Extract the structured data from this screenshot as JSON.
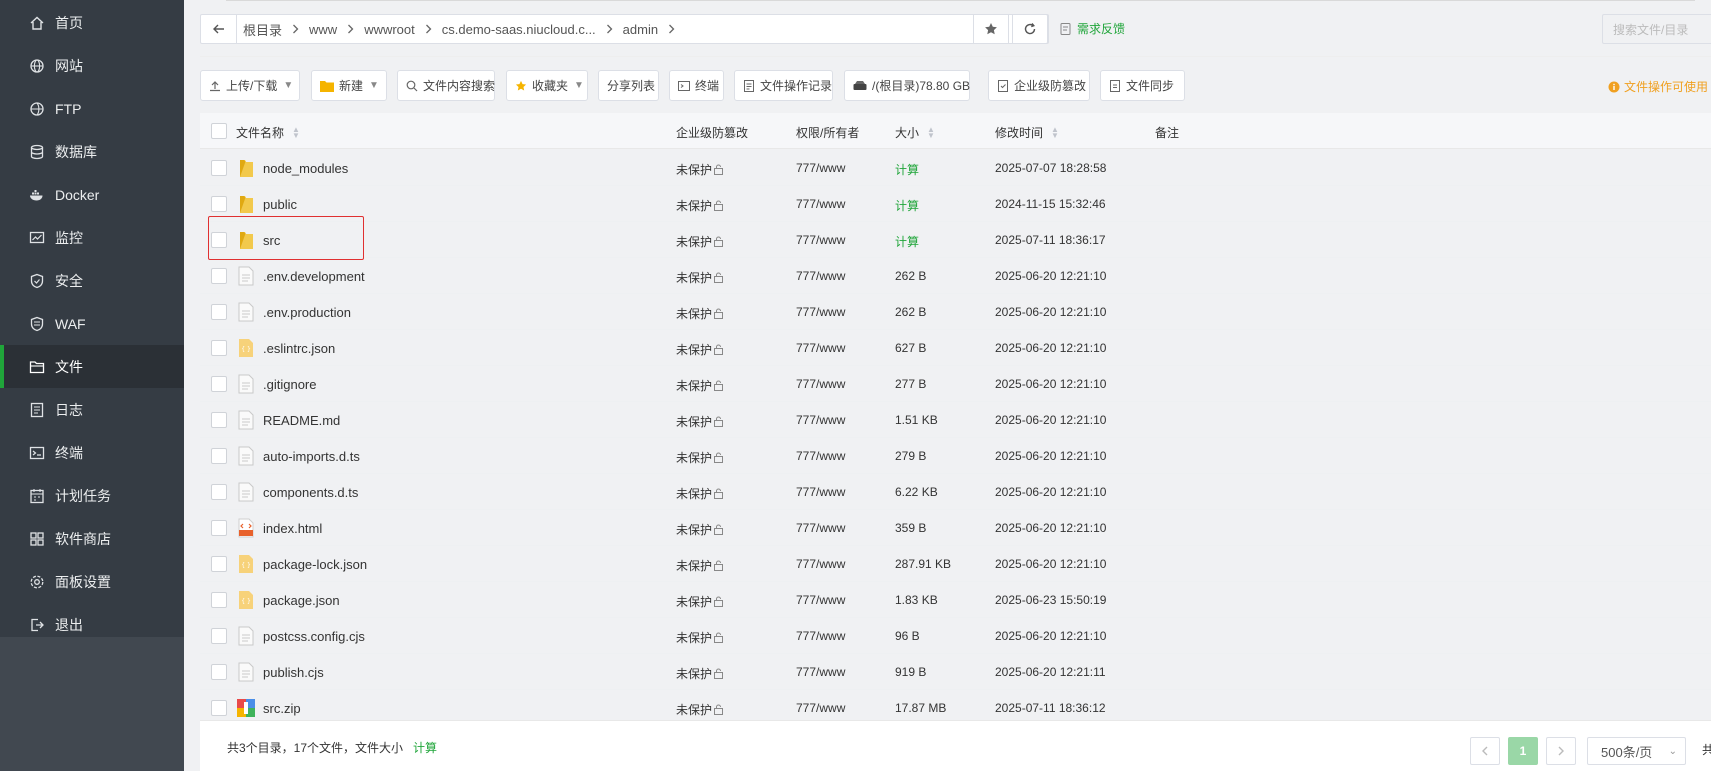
{
  "sidebar": {
    "items": [
      {
        "label": "首页",
        "icon": "home-icon"
      },
      {
        "label": "网站",
        "icon": "globe-icon"
      },
      {
        "label": "FTP",
        "icon": "ftp-icon"
      },
      {
        "label": "数据库",
        "icon": "database-icon"
      },
      {
        "label": "Docker",
        "icon": "docker-icon"
      },
      {
        "label": "监控",
        "icon": "monitor-icon"
      },
      {
        "label": "安全",
        "icon": "shield-icon"
      },
      {
        "label": "WAF",
        "icon": "waf-icon"
      },
      {
        "label": "文件",
        "icon": "folder-icon"
      },
      {
        "label": "日志",
        "icon": "log-icon"
      },
      {
        "label": "终端",
        "icon": "terminal-icon"
      },
      {
        "label": "计划任务",
        "icon": "calendar-icon"
      },
      {
        "label": "软件商店",
        "icon": "apps-icon"
      },
      {
        "label": "面板设置",
        "icon": "settings-icon"
      },
      {
        "label": "退出",
        "icon": "logout-icon"
      }
    ],
    "active": "文件"
  },
  "path": {
    "crumbs": [
      "根目录",
      "www",
      "wwwroot",
      "cs.demo-saas.niucloud.c...",
      "admin"
    ]
  },
  "feedback_label": "需求反馈",
  "search_placeholder": "搜索文件/目录",
  "toolbar": {
    "upload": "上传/下载",
    "new": "新建",
    "content_search": "文件内容搜索",
    "favorites": "收藏夹",
    "share_list": "分享列表",
    "terminal": "终端",
    "op_log": "文件操作记录",
    "disk": "/(根目录)78.80 GB",
    "tamper": "企业级防篡改",
    "sync": "文件同步",
    "tip": "文件操作可使用"
  },
  "table": {
    "headers": {
      "name": "文件名称",
      "tamper": "企业级防篡改",
      "perm": "权限/所有者",
      "size": "大小",
      "mtime": "修改时间",
      "note": "备注"
    },
    "rows": [
      {
        "name": "node_modules",
        "type": "folder",
        "tamper": "未保护",
        "perm": "777/www",
        "size": "计算",
        "mtime": "2025-07-07 18:28:58"
      },
      {
        "name": "public",
        "type": "folder",
        "tamper": "未保护",
        "perm": "777/www",
        "size": "计算",
        "mtime": "2024-11-15 15:32:46"
      },
      {
        "name": "src",
        "type": "folder",
        "tamper": "未保护",
        "perm": "777/www",
        "size": "计算",
        "mtime": "2025-07-11 18:36:17"
      },
      {
        "name": ".env.development",
        "type": "file",
        "tamper": "未保护",
        "perm": "777/www",
        "size": "262 B",
        "mtime": "2025-06-20 12:21:10"
      },
      {
        "name": ".env.production",
        "type": "file",
        "tamper": "未保护",
        "perm": "777/www",
        "size": "262 B",
        "mtime": "2025-06-20 12:21:10"
      },
      {
        "name": ".eslintrc.json",
        "type": "json",
        "tamper": "未保护",
        "perm": "777/www",
        "size": "627 B",
        "mtime": "2025-06-20 12:21:10"
      },
      {
        "name": ".gitignore",
        "type": "file",
        "tamper": "未保护",
        "perm": "777/www",
        "size": "277 B",
        "mtime": "2025-06-20 12:21:10"
      },
      {
        "name": "README.md",
        "type": "file",
        "tamper": "未保护",
        "perm": "777/www",
        "size": "1.51 KB",
        "mtime": "2025-06-20 12:21:10"
      },
      {
        "name": "auto-imports.d.ts",
        "type": "file",
        "tamper": "未保护",
        "perm": "777/www",
        "size": "279 B",
        "mtime": "2025-06-20 12:21:10"
      },
      {
        "name": "components.d.ts",
        "type": "file",
        "tamper": "未保护",
        "perm": "777/www",
        "size": "6.22 KB",
        "mtime": "2025-06-20 12:21:10"
      },
      {
        "name": "index.html",
        "type": "html",
        "tamper": "未保护",
        "perm": "777/www",
        "size": "359 B",
        "mtime": "2025-06-20 12:21:10"
      },
      {
        "name": "package-lock.json",
        "type": "json",
        "tamper": "未保护",
        "perm": "777/www",
        "size": "287.91 KB",
        "mtime": "2025-06-20 12:21:10"
      },
      {
        "name": "package.json",
        "type": "json",
        "tamper": "未保护",
        "perm": "777/www",
        "size": "1.83 KB",
        "mtime": "2025-06-23 15:50:19"
      },
      {
        "name": "postcss.config.cjs",
        "type": "file",
        "tamper": "未保护",
        "perm": "777/www",
        "size": "96 B",
        "mtime": "2025-06-20 12:21:10"
      },
      {
        "name": "publish.cjs",
        "type": "file",
        "tamper": "未保护",
        "perm": "777/www",
        "size": "919 B",
        "mtime": "2025-06-20 12:21:11"
      },
      {
        "name": "src.zip",
        "type": "zip",
        "tamper": "未保护",
        "perm": "777/www",
        "size": "17.87 MB",
        "mtime": "2025-07-11 18:36:12"
      }
    ]
  },
  "footer": {
    "summary": "共3个目录，17个文件，文件大小",
    "calc": "计算",
    "page": "1",
    "per_page": "500条/页",
    "tail": "共"
  },
  "colors": {
    "accent": "#20a53a",
    "sidebar": "#353c44",
    "highlight": "#e03030",
    "tip": "#f0a020"
  }
}
